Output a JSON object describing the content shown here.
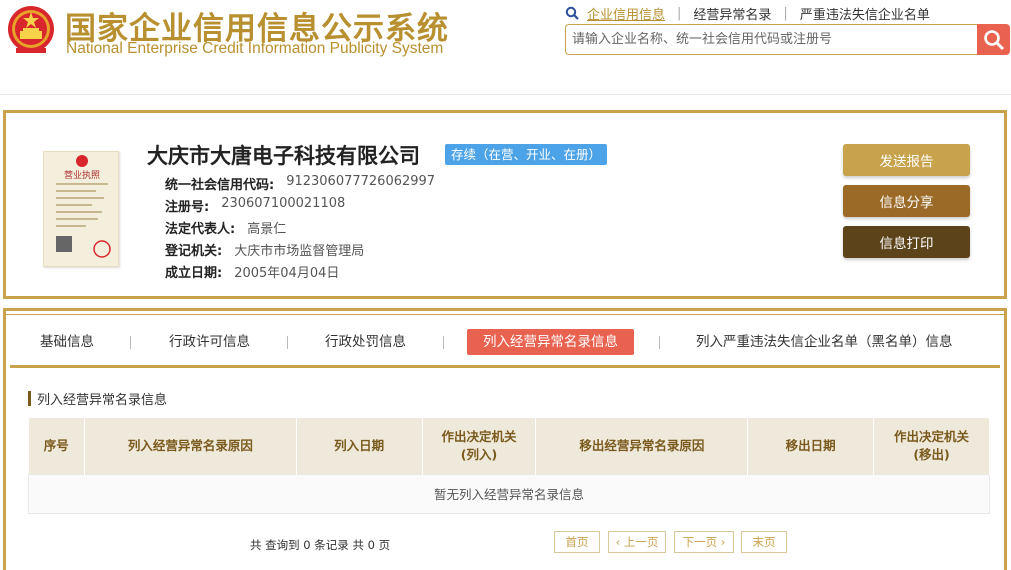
{
  "header": {
    "title_cn": "国家企业信用信息公示系统",
    "title_en": "National Enterprise Credit Information Publicity System",
    "nav": [
      "企业信用信息",
      "经营异常名录",
      "严重违法失信企业名单"
    ],
    "search_placeholder": "请输入企业名称、统一社会信用代码或注册号"
  },
  "company": {
    "name": "大庆市大唐电子科技有限公司",
    "status": "存续（在营、开业、在册）",
    "license_title": "营业执照",
    "fields": [
      {
        "label": "统一社会信用代码:",
        "value": "912306077726062997"
      },
      {
        "label": "注册号:",
        "value": "230607100021108"
      },
      {
        "label": "法定代表人:",
        "value": "高景仁"
      },
      {
        "label": "登记机关:",
        "value": "大庆市市场监督管理局"
      },
      {
        "label": "成立日期:",
        "value": "2005年04月04日"
      }
    ],
    "buttons": {
      "send": "发送报告",
      "share": "信息分享",
      "print": "信息打印"
    }
  },
  "tabs": [
    "基础信息",
    "行政许可信息",
    "行政处罚信息",
    "列入经营异常名录信息",
    "列入严重违法失信企业名单（黑名单）信息"
  ],
  "active_tab": 3,
  "section": {
    "title": "列入经营异常名录信息",
    "columns": [
      "序号",
      "列入经营异常名录原因",
      "列入日期",
      "作出决定机关\n(列入)",
      "移出经营异常名录原因",
      "移出日期",
      "作出决定机关\n(移出)"
    ],
    "empty_text": "暂无列入经营异常名录信息"
  },
  "pagination": {
    "summary": "共 查询到 0 条记录 共 0 页",
    "first": "首页",
    "prev": "‹ 上一页",
    "next": "下一页 ›",
    "last": "末页"
  },
  "colors": {
    "gold": "#c9a24c",
    "red": "#e8624f",
    "blue": "#4da3e7",
    "brown": "#9a6a26",
    "dark_brown": "#5c4319"
  }
}
